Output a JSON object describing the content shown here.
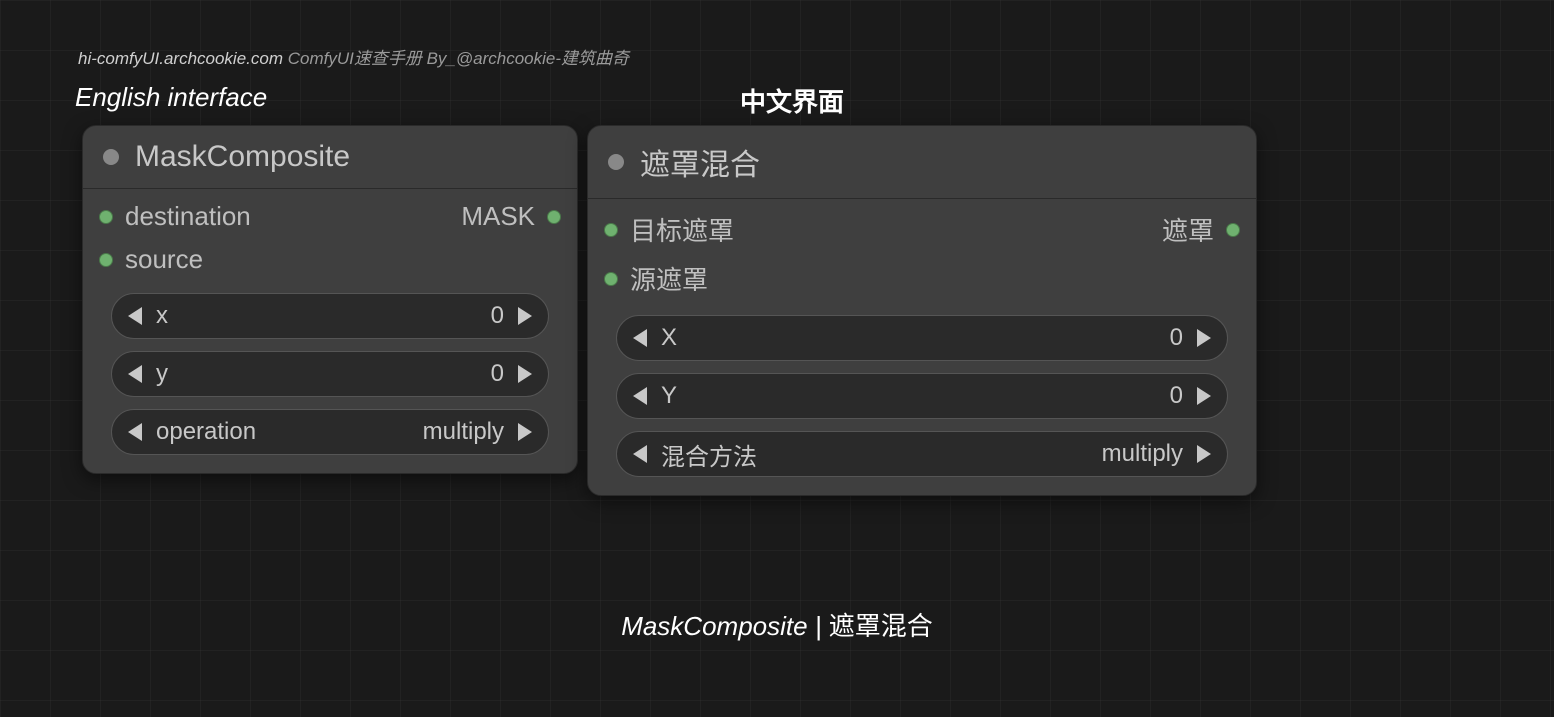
{
  "watermark": {
    "site": "hi-comfyUI.archcookie.com",
    "desc": " ComfyUI速查手册 By_@archcookie-建筑曲奇"
  },
  "labels": {
    "english": "English interface",
    "chinese": "中文界面"
  },
  "node_en": {
    "title": "MaskComposite",
    "inputs": {
      "destination": "destination",
      "source": "source"
    },
    "outputs": {
      "mask": "MASK"
    },
    "widgets": {
      "x_label": "x",
      "x_value": "0",
      "y_label": "y",
      "y_value": "0",
      "op_label": "operation",
      "op_value": "multiply"
    }
  },
  "node_cn": {
    "title": "遮罩混合",
    "inputs": {
      "destination": "目标遮罩",
      "source": "源遮罩"
    },
    "outputs": {
      "mask": "遮罩"
    },
    "widgets": {
      "x_label": "X",
      "x_value": "0",
      "y_label": "Y",
      "y_value": "0",
      "op_label": "混合方法",
      "op_value": "multiply"
    }
  },
  "caption": {
    "en": "MaskComposite",
    "sep": " | ",
    "cn": "遮罩混合"
  }
}
